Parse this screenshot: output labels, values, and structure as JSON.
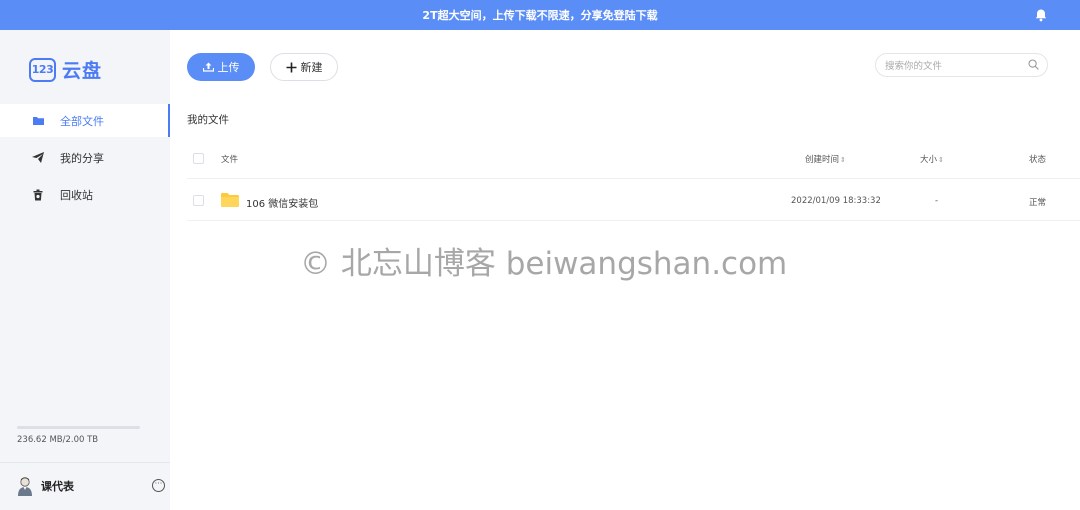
{
  "banner": {
    "text": "2T超大空间，上传下载不限速，分享免登陆下载",
    "icon": "bell-icon"
  },
  "logo": {
    "mark": "123",
    "text": "云盘"
  },
  "sidebar": {
    "items": [
      {
        "label": "全部文件",
        "icon": "folder-icon",
        "active": true
      },
      {
        "label": "我的分享",
        "icon": "send-icon",
        "active": false
      },
      {
        "label": "回收站",
        "icon": "trash-icon",
        "active": false
      }
    ],
    "storage": {
      "text": "236.62 MB/2.00 TB",
      "used_fraction": 0.0001
    },
    "user": {
      "name": "课代表",
      "more_icon": "more-icon"
    }
  },
  "toolbar": {
    "upload_label": "上传",
    "new_label": "新建"
  },
  "search": {
    "placeholder": "搜索你的文件"
  },
  "breadcrumb": "我的文件",
  "table": {
    "headers": {
      "name": "文件",
      "created": "创建时间",
      "size": "大小",
      "status": "状态"
    },
    "rows": [
      {
        "name": "106 微信安装包",
        "created": "2022/01/09 18:33:32",
        "size": "-",
        "status": "正常"
      }
    ]
  },
  "watermark": "© 北忘山博客 beiwangshan.com",
  "colors": {
    "accent": "#5b8df6",
    "sidebar_bg": "#f4f5f9",
    "folder": "#ffc93c"
  }
}
